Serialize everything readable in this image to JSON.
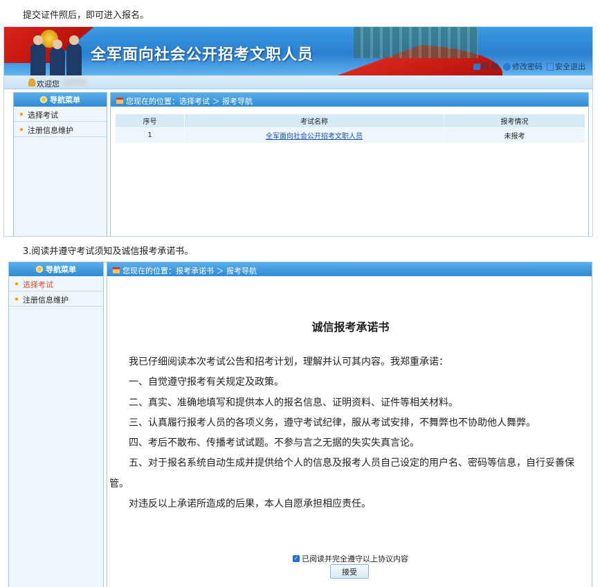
{
  "captions": {
    "step_intro": "提交证件照后，即可进入报名。",
    "step3": "3.阅读并遵守考试须知及诚信报考承诺书。"
  },
  "header": {
    "title": "全军面向社会公开招考文职人员",
    "links": {
      "help": "帮 助",
      "change_password": "修改密码",
      "logout": "安全退出"
    },
    "welcome": "欢迎您"
  },
  "sidebar": {
    "title": "导航菜单",
    "items": [
      {
        "label": "选择考试"
      },
      {
        "label": "注册信息维护"
      }
    ]
  },
  "screen1": {
    "breadcrumb": "您现在的位置：选择考试 ＞ 报考导航",
    "table": {
      "headers": [
        "序号",
        "考试名称",
        "报考情况"
      ],
      "rows": [
        {
          "index": "1",
          "name": "全军面向社会公开招考文职人员",
          "status": "未报考"
        }
      ]
    }
  },
  "screen2": {
    "breadcrumb": "您现在的位置：报考承诺书 ＞ 报考导航",
    "pledge_title": "诚信报考承诺书",
    "paragraphs": [
      "我已仔细阅读本次考试公告和招考计划，理解并认可其内容。我郑重承诺：",
      "一、自觉遵守报考有关规定及政策。",
      "二、真实、准确地填写和提供本人的报名信息、证明资料、证件等相关材料。",
      "三、认真履行报考人员的各项义务，遵守考试纪律，服从考试安排，不舞弊也不协助他人舞弊。",
      "四、考后不散布、传播考试试题。不参与言之无据的失实失真言论。",
      "五、对于报名系统自动生成并提供给个人的信息及报考人员自己设定的用户名、密码等信息，自行妥善保管。",
      "对违反以上承诺所造成的后果，本人自愿承担相应责任。"
    ],
    "agree_checkbox": "已阅读并完全遵守以上协议内容",
    "accept_button": "接受"
  },
  "colors": {
    "header_blue": "#2f8bd6",
    "flag_red": "#d7261c",
    "active_item": "#e04a2a"
  },
  "icons": [
    "lock-icon",
    "help-icon",
    "key-icon",
    "exit-icon",
    "user-icon",
    "menu-icon",
    "home-icon",
    "checkbox-checked-icon"
  ]
}
